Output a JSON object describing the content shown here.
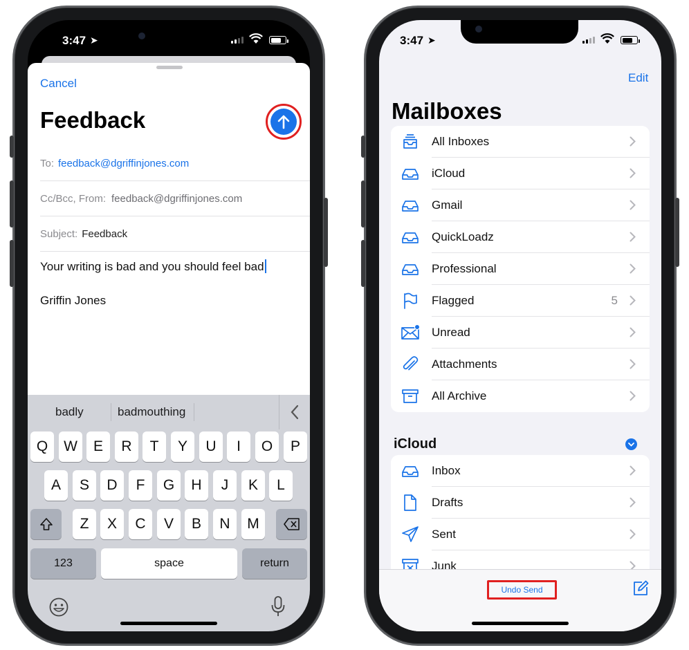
{
  "status_bar": {
    "time": "3:47"
  },
  "compose": {
    "cancel_label": "Cancel",
    "title": "Feedback",
    "to_label": "To:",
    "to_value": "feedback@dgriffinjones.com",
    "ccbcc_label": "Cc/Bcc, From:",
    "from_value": "feedback@dgriffinjones.com",
    "subject_label": "Subject:",
    "subject_value": "Feedback",
    "body_line1": "Your writing is bad and you should feel bad",
    "body_line2": "Griffin Jones"
  },
  "keyboard": {
    "suggestions": [
      "badly",
      "badmouthing"
    ],
    "row1": [
      "Q",
      "W",
      "E",
      "R",
      "T",
      "Y",
      "U",
      "I",
      "O",
      "P"
    ],
    "row2": [
      "A",
      "S",
      "D",
      "F",
      "G",
      "H",
      "J",
      "K",
      "L"
    ],
    "row3": [
      "Z",
      "X",
      "C",
      "V",
      "B",
      "N",
      "M"
    ],
    "numbers_label": "123",
    "space_label": "space",
    "return_label": "return"
  },
  "mailboxes": {
    "edit_label": "Edit",
    "title": "Mailboxes",
    "top_items": [
      {
        "label": "All Inboxes",
        "icon": "all-inboxes-icon"
      },
      {
        "label": "iCloud",
        "icon": "inbox-tray-icon"
      },
      {
        "label": "Gmail",
        "icon": "inbox-tray-icon"
      },
      {
        "label": "QuickLoadz",
        "icon": "inbox-tray-icon"
      },
      {
        "label": "Professional",
        "icon": "inbox-tray-icon"
      },
      {
        "label": "Flagged",
        "icon": "flag-icon",
        "count": "5"
      },
      {
        "label": "Unread",
        "icon": "unread-envelope-icon"
      },
      {
        "label": "Attachments",
        "icon": "paperclip-icon"
      },
      {
        "label": "All Archive",
        "icon": "archive-box-icon"
      }
    ],
    "section_title": "iCloud",
    "section_items": [
      {
        "label": "Inbox",
        "icon": "inbox-tray-icon"
      },
      {
        "label": "Drafts",
        "icon": "document-icon"
      },
      {
        "label": "Sent",
        "icon": "paper-plane-icon"
      },
      {
        "label": "Junk",
        "icon": "junk-bin-icon"
      }
    ],
    "undo_send_label": "Undo Send"
  },
  "colors": {
    "accent": "#1a73e8",
    "highlight": "#e02020",
    "keyboard_bg": "#d1d3d9",
    "list_bg": "#f2f2f7"
  }
}
